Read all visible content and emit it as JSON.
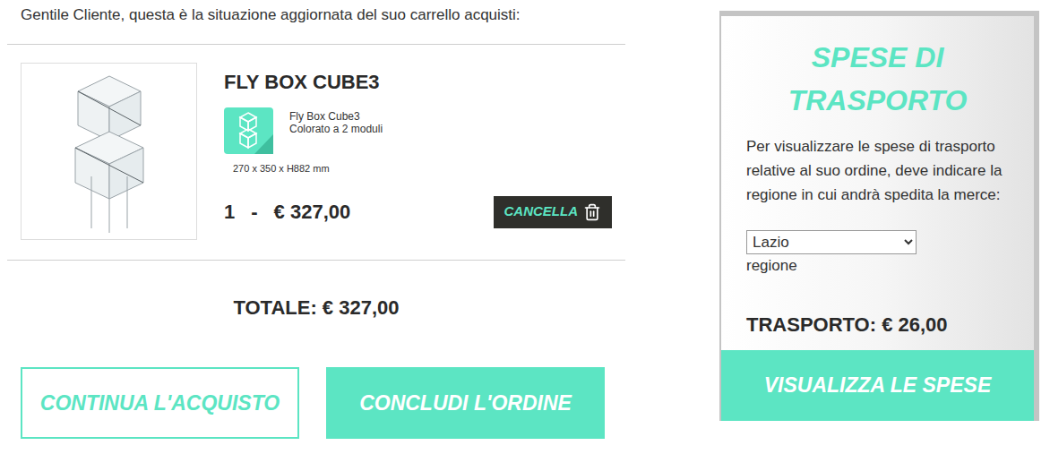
{
  "intro": "Gentile Cliente, questa è la situazione aggiornata del suo carrello acquisti:",
  "cart_items": [
    {
      "title": "FLY BOX CUBE3",
      "variant_name": "Fly Box Cube3",
      "variant_detail": "Colorato a 2 moduli",
      "dimensions": "270 x 350 x H882 mm",
      "quantity": "1",
      "separator": "-",
      "price": "€ 327,00",
      "delete_button": "CANCELLA"
    }
  ],
  "total": "TOTALE: € 327,00",
  "buttons": [
    {
      "label": "CONTINUA L'ACQUISTO",
      "kind": "outline"
    },
    {
      "label": "CONCLUDI L'ORDINE",
      "kind": "filled"
    }
  ],
  "shipping": {
    "title": "SPESE DI TRASPORTO",
    "description": "Per visualizzare le spese di trasporto relative al suo ordine, deve indicare la regione in cui andrà spedita la merce:",
    "region": {
      "value": "Lazio",
      "label": "regione"
    },
    "cost": "TRASPORTO: € 26,00",
    "button": "VISUALIZZA LE SPESE"
  }
}
